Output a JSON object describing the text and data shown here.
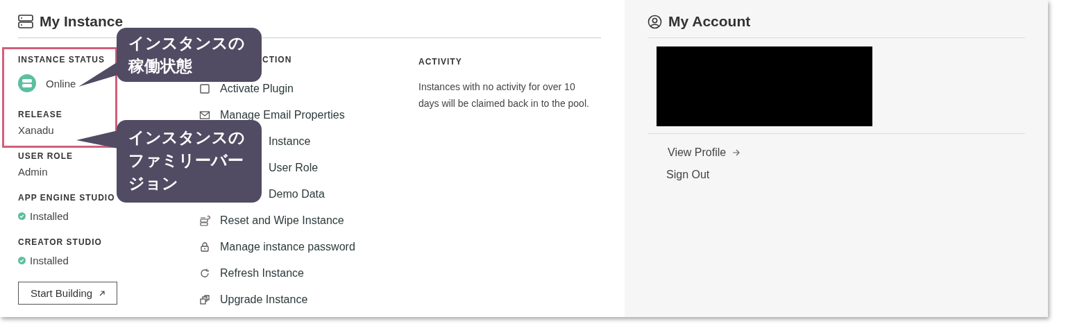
{
  "my_instance": {
    "title": "My Instance",
    "details": [
      {
        "label": "INSTANCE STATUS",
        "value": "Online",
        "kind": "status"
      },
      {
        "label": "RELEASE",
        "value": "Xanadu",
        "kind": "text"
      },
      {
        "label": "USER ROLE",
        "value": "Admin",
        "kind": "text"
      },
      {
        "label": "APP ENGINE STUDIO",
        "value": "Installed",
        "kind": "installed"
      },
      {
        "label": "CREATOR STUDIO",
        "value": "Installed",
        "kind": "installed"
      }
    ],
    "start_button": "Start Building",
    "actions": {
      "heading": "CTION",
      "items": [
        {
          "label": "Activate Plugin",
          "kind": "full"
        },
        {
          "label": "Manage Email Properties",
          "kind": "full"
        },
        {
          "label": "Instance",
          "kind": "covered"
        },
        {
          "label": "User Role",
          "kind": "covered"
        },
        {
          "label": "Demo Data",
          "kind": "covered"
        },
        {
          "label": "Reset and Wipe Instance",
          "kind": "full"
        },
        {
          "label": "Manage instance password",
          "kind": "full"
        },
        {
          "label": "Refresh Instance",
          "kind": "full"
        },
        {
          "label": "Upgrade Instance",
          "kind": "full"
        }
      ]
    },
    "activity": {
      "heading": "ACTIVITY",
      "text": "Instances with no activity for over 10 days will be claimed back in to the pool."
    }
  },
  "my_account": {
    "title": "My Account",
    "links": [
      "View Profile",
      "Sign Out"
    ]
  },
  "callouts": [
    "インスタンスの稼働状態",
    "インスタンスのファミリーバージョン"
  ]
}
